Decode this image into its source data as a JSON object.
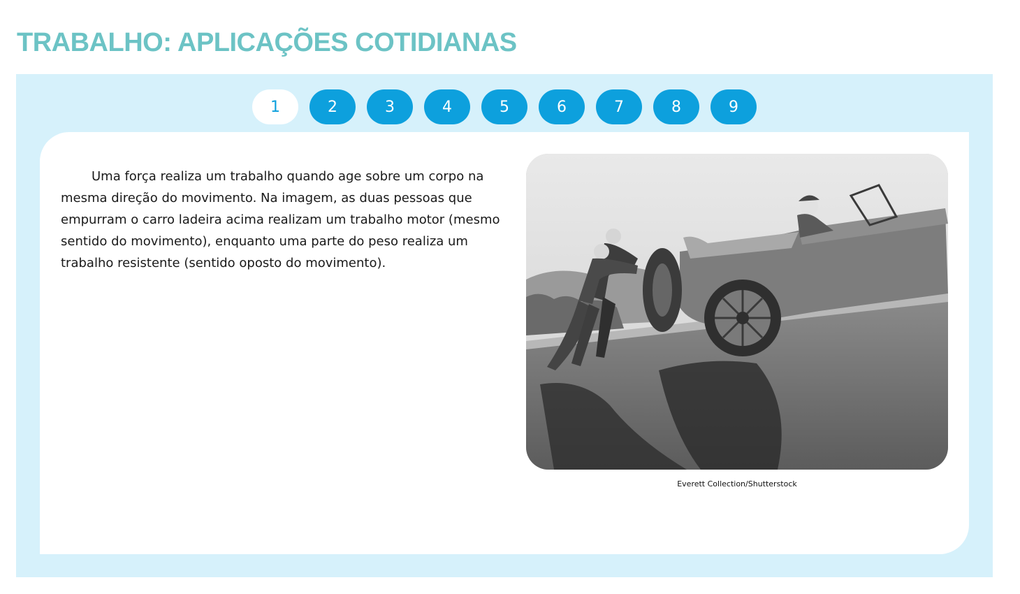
{
  "header": {
    "title": "TRABALHO: APLICAÇÕES COTIDIANAS"
  },
  "pagination": {
    "pages": [
      "1",
      "2",
      "3",
      "4",
      "5",
      "6",
      "7",
      "8",
      "9"
    ],
    "current": "1"
  },
  "content": {
    "paragraph": "Uma força realiza um trabalho quando age sobre um corpo na mesma direção do movimento. Na imagem, as duas pessoas que empurram o carro ladeira acima realizam um trabalho motor (mesmo sentido do movimento), enquanto uma parte do peso realiza um trabalho resistente (sentido oposto do movimento).",
    "image_credit": "Everett Collection/Shutterstock"
  },
  "colors": {
    "title": "#6cc3c5",
    "panel_background": "#d6f1fb",
    "page_button": "#0da0dd",
    "page_button_active_bg": "#ffffff"
  }
}
